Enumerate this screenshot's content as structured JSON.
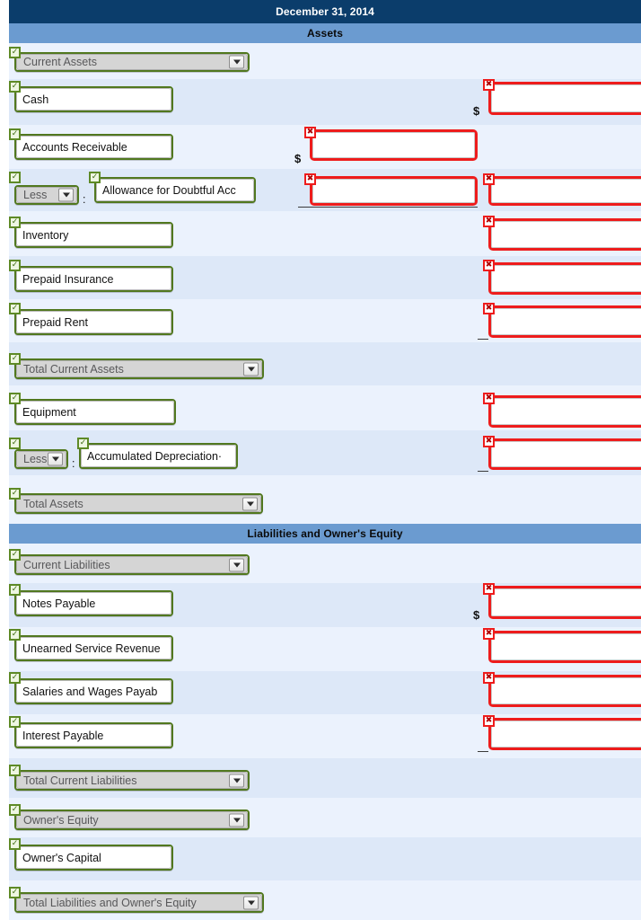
{
  "header": {
    "date_title": "December 31, 2014",
    "assets_title": "Assets",
    "liabilities_title": "Liabilities and Owner's Equity"
  },
  "colors": {
    "date_banner": "#0b3d6b",
    "section_banner": "#6b9bd0",
    "row_dark": "#dde8f8",
    "row_light": "#ebf2fd",
    "valid_border": "#51781f",
    "invalid_border": "#ee1c1c",
    "select_bg": "#d5d5d5"
  },
  "glyphs": {
    "tick": "✓",
    "cross": "✖",
    "dollar": "$",
    "colon": ":",
    "less_label": "Less"
  },
  "rows": [
    {
      "id": "current-assets",
      "label": "Current Assets",
      "kind": "select"
    },
    {
      "id": "cash",
      "label": "Cash",
      "kind": "text"
    },
    {
      "id": "accounts-receivable",
      "label": "Accounts Receivable",
      "kind": "text"
    },
    {
      "id": "allowance-doubtful",
      "label": "Allowance for Doubtful Acc",
      "kind": "less"
    },
    {
      "id": "inventory",
      "label": "Inventory",
      "kind": "text"
    },
    {
      "id": "prepaid-insurance",
      "label": "Prepaid Insurance",
      "kind": "text"
    },
    {
      "id": "prepaid-rent",
      "label": "Prepaid Rent",
      "kind": "text"
    },
    {
      "id": "total-current-assets",
      "label": "Total Current Assets",
      "kind": "select"
    },
    {
      "id": "equipment",
      "label": "Equipment",
      "kind": "text"
    },
    {
      "id": "accumulated-depr",
      "label": "Accumulated Depreciation·",
      "kind": "less"
    },
    {
      "id": "total-assets",
      "label": "Total Assets",
      "kind": "select"
    },
    {
      "id": "current-liabilities",
      "label": "Current Liabilities",
      "kind": "select"
    },
    {
      "id": "notes-payable",
      "label": "Notes Payable",
      "kind": "text"
    },
    {
      "id": "unearned-service-rev",
      "label": "Unearned Service Revenue",
      "kind": "text"
    },
    {
      "id": "salaries-wages-payable",
      "label": "Salaries and Wages Payab",
      "kind": "text"
    },
    {
      "id": "interest-payable",
      "label": "Interest Payable",
      "kind": "text"
    },
    {
      "id": "total-current-liab",
      "label": "Total Current Liabilities",
      "kind": "select"
    },
    {
      "id": "owners-equity",
      "label": "Owner's Equity",
      "kind": "select"
    },
    {
      "id": "owners-capital",
      "label": "Owner's Capital",
      "kind": "text"
    },
    {
      "id": "total-liab-equity",
      "label": "Total Liabilities and Owner's Equity",
      "kind": "select"
    }
  ],
  "amount_inputs": [
    {
      "row": "cash",
      "column": "right",
      "value": ""
    },
    {
      "row": "accounts-receivable",
      "column": "middle",
      "value": ""
    },
    {
      "row": "allowance-doubtful",
      "column": "middle",
      "value": ""
    },
    {
      "row": "allowance-doubtful",
      "column": "right",
      "value": ""
    },
    {
      "row": "inventory",
      "column": "right",
      "value": ""
    },
    {
      "row": "prepaid-insurance",
      "column": "right",
      "value": ""
    },
    {
      "row": "prepaid-rent",
      "column": "right",
      "value": ""
    },
    {
      "row": "equipment",
      "column": "right",
      "value": ""
    },
    {
      "row": "accumulated-depr",
      "column": "right",
      "value": ""
    },
    {
      "row": "notes-payable",
      "column": "right",
      "value": ""
    },
    {
      "row": "unearned-service-rev",
      "column": "right",
      "value": ""
    },
    {
      "row": "salaries-wages-payable",
      "column": "right",
      "value": ""
    },
    {
      "row": "interest-payable",
      "column": "right",
      "value": ""
    }
  ]
}
